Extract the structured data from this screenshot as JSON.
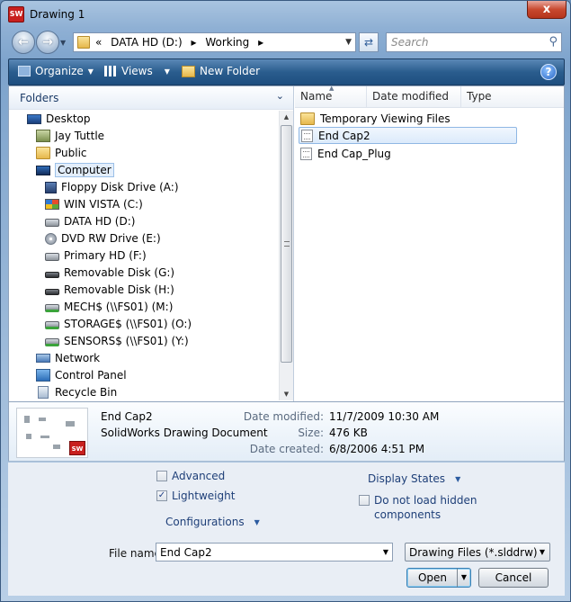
{
  "window": {
    "title": "Drawing 1",
    "app_icon": "SW",
    "close": "x"
  },
  "nav": {
    "back_icon": "back-arrow",
    "forward_icon": "forward-arrow",
    "address": [
      "«",
      "DATA HD (D:)",
      "▸",
      "Working",
      "▸"
    ],
    "search_placeholder": "Search"
  },
  "toolbar": {
    "organize": "Organize",
    "views": "Views",
    "new_folder": "New Folder",
    "help": "?"
  },
  "folders": {
    "title": "Folders",
    "items": [
      {
        "label": "Desktop",
        "icon": "desktop"
      },
      {
        "label": "Jay Tuttle",
        "icon": "user"
      },
      {
        "label": "Public",
        "icon": "folder"
      },
      {
        "label": "Computer",
        "icon": "computer"
      },
      {
        "label": "Floppy Disk Drive (A:)",
        "icon": "floppy"
      },
      {
        "label": "WIN VISTA (C:)",
        "icon": "windows-drive"
      },
      {
        "label": "DATA HD (D:)",
        "icon": "drive"
      },
      {
        "label": "DVD RW Drive (E:)",
        "icon": "dvd"
      },
      {
        "label": "Primary HD (F:)",
        "icon": "drive"
      },
      {
        "label": "Removable Disk (G:)",
        "icon": "removable"
      },
      {
        "label": "Removable Disk (H:)",
        "icon": "removable"
      },
      {
        "label": "MECH$ (\\\\FS01) (M:)",
        "icon": "network-drive"
      },
      {
        "label": "STORAGE$ (\\\\FS01) (O:)",
        "icon": "network-drive"
      },
      {
        "label": "SENSORS$ (\\\\FS01) (Y:)",
        "icon": "network-drive"
      },
      {
        "label": "Network",
        "icon": "network"
      },
      {
        "label": "Control Panel",
        "icon": "control-panel"
      },
      {
        "label": "Recycle Bin",
        "icon": "recycle-bin"
      }
    ]
  },
  "columns": {
    "name": "Name",
    "date_modified": "Date modified",
    "type": "Type"
  },
  "files": [
    {
      "name": "Temporary Viewing Files",
      "icon": "folder"
    },
    {
      "name": "End Cap2",
      "icon": "drawing-doc"
    },
    {
      "name": "End Cap_Plug",
      "icon": "drawing-doc"
    }
  ],
  "preview": {
    "name": "End Cap2",
    "type": "SolidWorks Drawing Document",
    "date_modified_label": "Date modified:",
    "date_modified": "11/7/2009 10:30 AM",
    "size_label": "Size:",
    "size": "476 KB",
    "date_created_label": "Date created:",
    "date_created": "6/8/2006 4:51 PM",
    "badge": "SW"
  },
  "options": {
    "advanced": "Advanced",
    "lightweight": "Lightweight",
    "configurations": "Configurations",
    "display_states": "Display States",
    "no_hidden": "Do not load hidden",
    "no_hidden_2": "components",
    "lightweight_checked": true,
    "advanced_checked": false,
    "no_hidden_checked": false
  },
  "filename": {
    "label": "File name:",
    "value": "End Cap2"
  },
  "filetype": {
    "value": "Drawing Files (*.slddrw)"
  },
  "buttons": {
    "open": "Open",
    "cancel": "Cancel"
  }
}
